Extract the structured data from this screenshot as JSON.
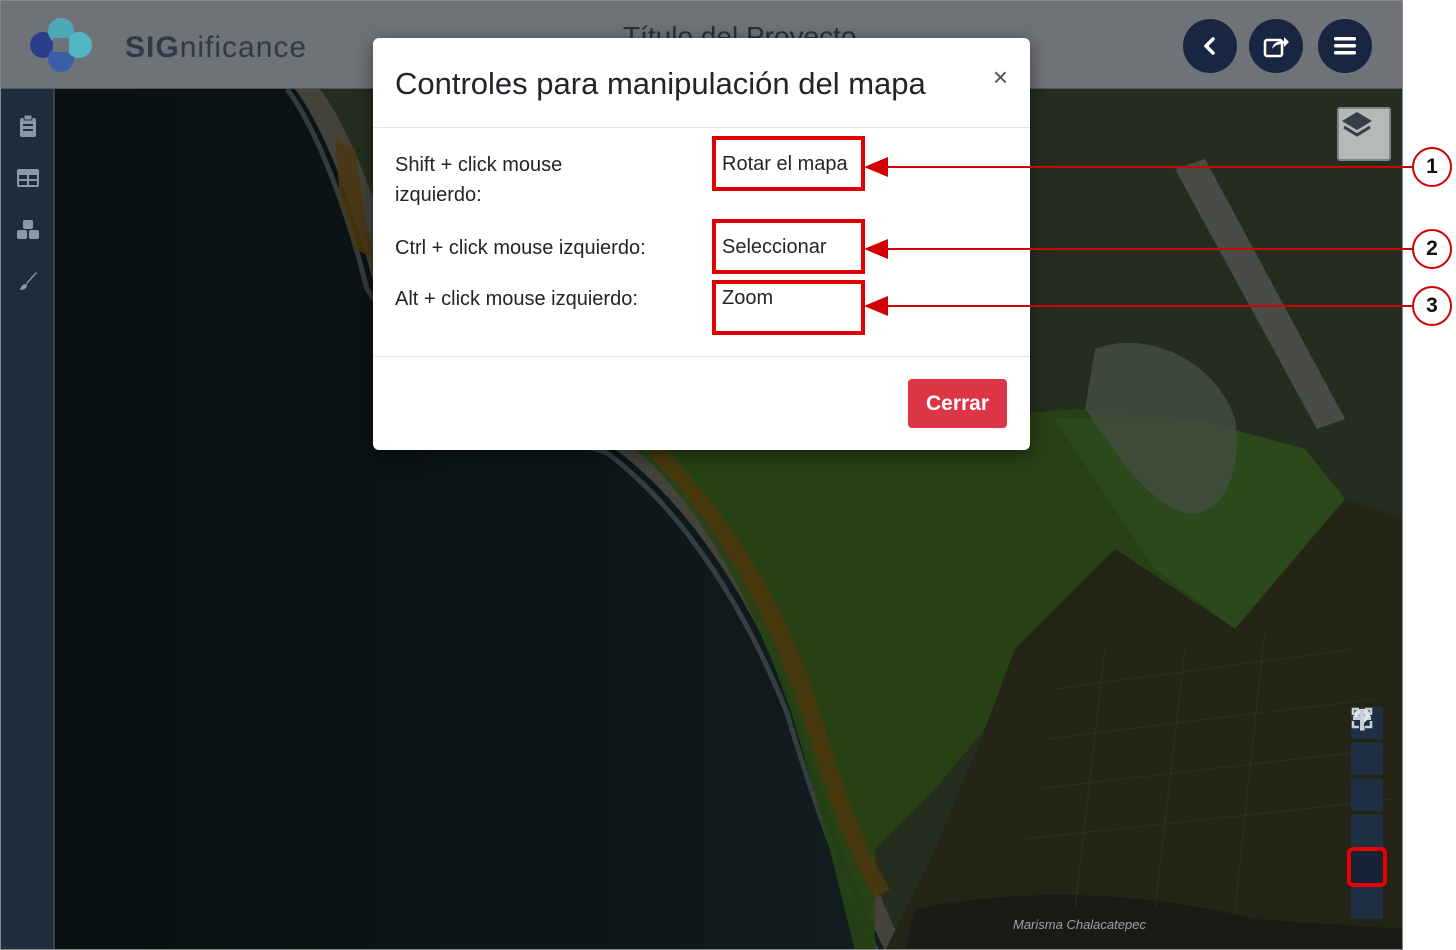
{
  "header": {
    "brand_bold": "SIG",
    "brand_light": "nificance",
    "project_title": "Título del Proyecto",
    "buttons": [
      "back-icon",
      "share-icon",
      "menu-icon"
    ]
  },
  "sidebar": {
    "items": [
      "clipboard-icon",
      "table-icon",
      "layers-stack-icon",
      "paintbrush-icon"
    ]
  },
  "map": {
    "attribution": "Marisma Chalacatepec",
    "controls": [
      "fullscreen-icon",
      "zoom-in-icon",
      "zoom-out-icon",
      "north-arrow-icon",
      "help-icon",
      "info-icon"
    ]
  },
  "modal": {
    "title": "Controles para manipulación del mapa",
    "close": "×",
    "rows": [
      {
        "label_line1": "Shift + click mouse",
        "label_line2": "izquierdo:",
        "value": "Rotar el mapa"
      },
      {
        "label_line1": "Ctrl + click mouse izquierdo:",
        "label_line2": "",
        "value": "Seleccionar"
      },
      {
        "label_line1": "Alt + click mouse izquierdo:",
        "label_line2": "",
        "value": "Zoom"
      }
    ],
    "close_button": "Cerrar"
  },
  "annotations": {
    "callouts": [
      "1",
      "2",
      "3"
    ],
    "highlight_color": "#e00000"
  },
  "colors": {
    "accent_red": "#dc3545",
    "navy": "#182642"
  }
}
